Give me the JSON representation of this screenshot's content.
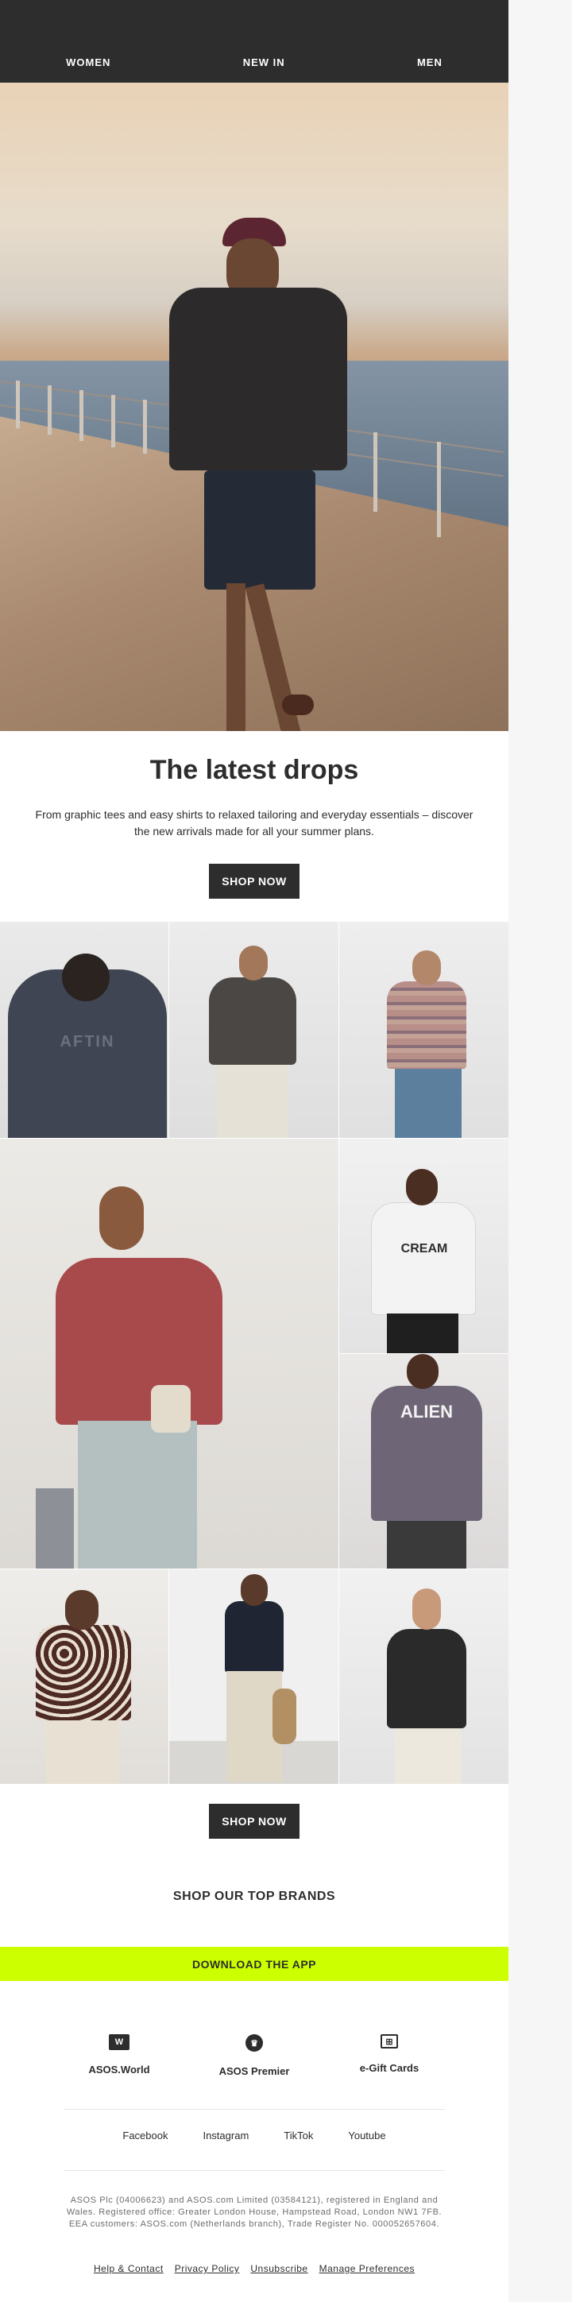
{
  "nav": {
    "women": "WOMEN",
    "new_in": "NEW IN",
    "men": "MEN"
  },
  "intro": {
    "title": "The latest drops",
    "body": "From graphic tees and easy shirts to relaxed tailoring and everyday essentials – discover the new arrivals made for all your summer plans.",
    "cta": "SHOP NOW"
  },
  "grid": {
    "tee1_print": "AFTIN",
    "tee2_print": "CREAM",
    "tee3_print": "ALIEN"
  },
  "cta2": "SHOP NOW",
  "brands_heading": "SHOP OUR TOP BRANDS",
  "app_banner": "DOWNLOAD THE APP",
  "features": [
    {
      "label": "ASOS.World",
      "icon": "asos-world-icon",
      "glyph": "W"
    },
    {
      "label": "ASOS Premier",
      "icon": "crown-icon",
      "glyph": "♛"
    },
    {
      "label": "e-Gift Cards",
      "icon": "gift-card-icon",
      "glyph": "⊞"
    }
  ],
  "social": [
    "Facebook",
    "Instagram",
    "TikTok",
    "Youtube"
  ],
  "legal": "ASOS Plc (04006623) and ASOS.com Limited (03584121), registered in England and Wales. Registered office: Greater London House, Hampstead Road, London NW1 7FB. EEA customers: ASOS.com (Netherlands branch), Trade Register No. 000052657604.",
  "footer_links": [
    "Help & Contact",
    "Privacy Policy",
    "Unsubscribe",
    "Manage Preferences"
  ],
  "colors": {
    "dark": "#2d2d2d",
    "lime": "#ccff00",
    "white": "#ffffff"
  }
}
